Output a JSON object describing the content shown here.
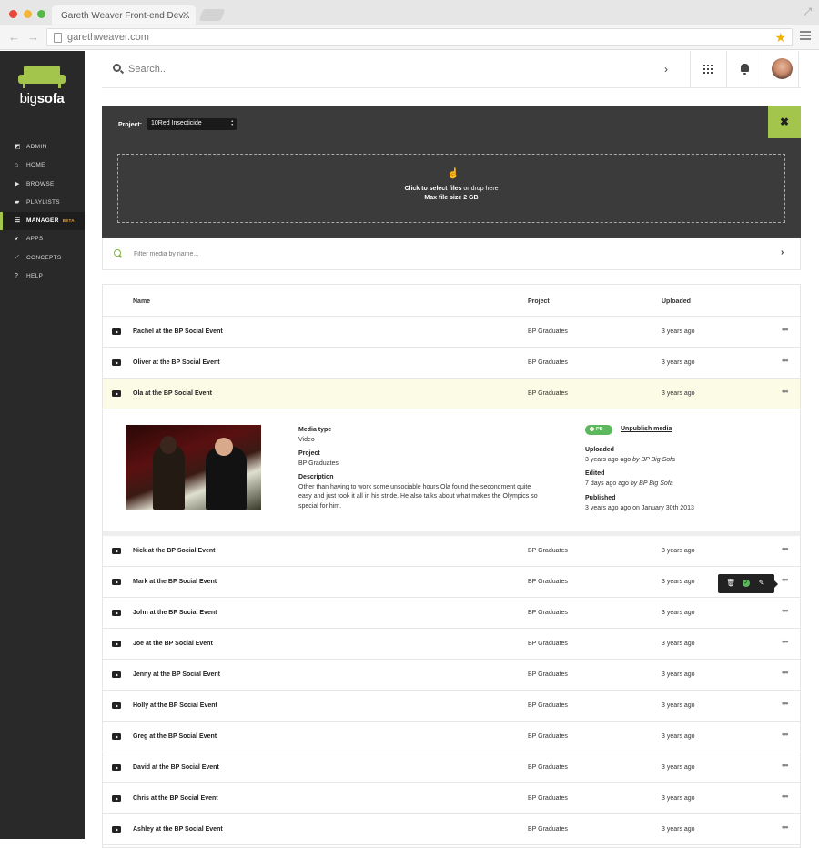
{
  "browser": {
    "tab_title": "Gareth Weaver Front-end Dev...",
    "url": "garethweaver.com"
  },
  "logo": {
    "prefix": "big",
    "suffix": "sofa"
  },
  "sidebar": {
    "items": [
      {
        "label": "ADMIN",
        "icon": "admin-icon"
      },
      {
        "label": "HOME",
        "icon": "home-icon"
      },
      {
        "label": "BROWSE",
        "icon": "browse-icon"
      },
      {
        "label": "PLAYLISTS",
        "icon": "folder-icon"
      },
      {
        "label": "MANAGER",
        "icon": "list-icon",
        "active": true,
        "badge": "BETA"
      },
      {
        "label": "APPS",
        "icon": "rocket-icon"
      },
      {
        "label": "CONCEPTS",
        "icon": "chart-icon"
      },
      {
        "label": "HELP",
        "icon": "help-icon"
      }
    ]
  },
  "appbar": {
    "search_placeholder": "Search..."
  },
  "upload": {
    "project_label": "Project:",
    "project_value": "10Red Insecticide",
    "drop_bold": "Click to select files",
    "drop_text": " or drop here",
    "max_size": "Max file size 2 GB"
  },
  "filter": {
    "placeholder": "Filter media by name..."
  },
  "table": {
    "headers": {
      "name": "Name",
      "project": "Project",
      "uploaded": "Uploaded"
    },
    "rows_before": [
      {
        "name": "Rachel at the BP Social Event",
        "project": "BP Graduates",
        "uploaded": "3 years ago"
      },
      {
        "name": "Oliver at the BP Social Event",
        "project": "BP Graduates",
        "uploaded": "3 years ago"
      },
      {
        "name": "Ola at the BP Social Event",
        "project": "BP Graduates",
        "uploaded": "3 years ago"
      }
    ],
    "rows_after": [
      {
        "name": "Nick at the BP Social Event",
        "project": "BP Graduates",
        "uploaded": "3 years ago"
      },
      {
        "name": "Mark at the BP Social Event",
        "project": "BP Graduates",
        "uploaded": "3 years ago"
      },
      {
        "name": "John at the BP Social Event",
        "project": "BP Graduates",
        "uploaded": "3 years ago"
      },
      {
        "name": "Joe at the BP Social Event",
        "project": "BP Graduates",
        "uploaded": "3 years ago"
      },
      {
        "name": "Jenny at the BP Social Event",
        "project": "BP Graduates",
        "uploaded": "3 years ago"
      },
      {
        "name": "Holly at the BP Social Event",
        "project": "BP Graduates",
        "uploaded": "3 years ago"
      },
      {
        "name": "Greg at the BP Social Event",
        "project": "BP Graduates",
        "uploaded": "3 years ago"
      },
      {
        "name": "David at the BP Social Event",
        "project": "BP Graduates",
        "uploaded": "3 years ago"
      },
      {
        "name": "Chris at the BP Social Event",
        "project": "BP Graduates",
        "uploaded": "3 years ago"
      },
      {
        "name": "Ashley at the BP Social Event",
        "project": "BP Graduates",
        "uploaded": "3 years ago"
      }
    ]
  },
  "detail": {
    "media_type_label": "Media type",
    "media_type": "Video",
    "project_label": "Project",
    "project": "BP Graduates",
    "description_label": "Description",
    "description": "Other than having to work some unsociable hours Ola found the secondment quite easy and just took it all in his stride. He also talks about what makes the Olympics so special for him.",
    "badge": "PB",
    "unpublish": "Unpublish media",
    "uploaded_label": "Uploaded",
    "uploaded": "3 years ago ago",
    "uploaded_by": "by BP Big Sofa",
    "edited_label": "Edited",
    "edited": "7 days ago ago",
    "edited_by": "by BP Big Sofa",
    "published_label": "Published",
    "published": "3 years ago ago on January 30th 2013"
  },
  "colors": {
    "accent": "#a3c54b",
    "sidebar": "#292929",
    "panel": "#3b3b3b",
    "publish": "#5cb85c"
  }
}
